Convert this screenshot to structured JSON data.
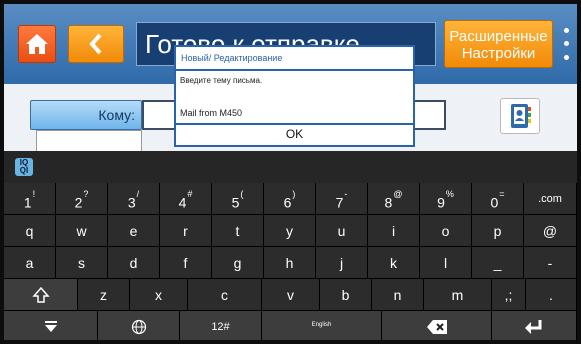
{
  "header": {
    "title": "Готово к отправке",
    "advanced": [
      "Расширенные",
      "Настройки"
    ]
  },
  "recipient": {
    "to_label": "Кому:"
  },
  "dialog": {
    "title": "Новый/ Редактирование",
    "prompt": "Введите тему письма.",
    "input_value": "Mail from  M450",
    "ok_label": "OK"
  },
  "keyboard": {
    "logo_lines": [
      "IQ",
      "QI"
    ],
    "number_row": [
      {
        "main": "1",
        "sup": "!"
      },
      {
        "main": "2",
        "sup": "?"
      },
      {
        "main": "3",
        "sup": "/"
      },
      {
        "main": "4",
        "sup": "#"
      },
      {
        "main": "5",
        "sup": "("
      },
      {
        "main": "6",
        "sup": ")"
      },
      {
        "main": "7",
        "sup": "-"
      },
      {
        "main": "8",
        "sup": "@"
      },
      {
        "main": "9",
        "sup": "%"
      },
      {
        "main": "0",
        "sup": "="
      },
      {
        "main": ".com",
        "sup": ""
      }
    ],
    "row2": [
      "q",
      "w",
      "e",
      "r",
      "t",
      "y",
      "u",
      "i",
      "o",
      "p",
      "@"
    ],
    "row3": [
      "a",
      "s",
      "d",
      "f",
      "g",
      "h",
      "j",
      "k",
      "l",
      "_",
      "-"
    ],
    "row4": [
      "z",
      "x",
      "c",
      "v",
      "b",
      "n",
      "m",
      ",;",
      "."
    ],
    "bottom": {
      "symbols": "12#",
      "language": "English"
    }
  },
  "colors": {
    "header": "#2f6aa9",
    "home_button": "#e84e12",
    "accent_orange": "#f28a08",
    "dialog_border": "#2b63a8",
    "keyboard_bg": "#1a1a1a"
  }
}
